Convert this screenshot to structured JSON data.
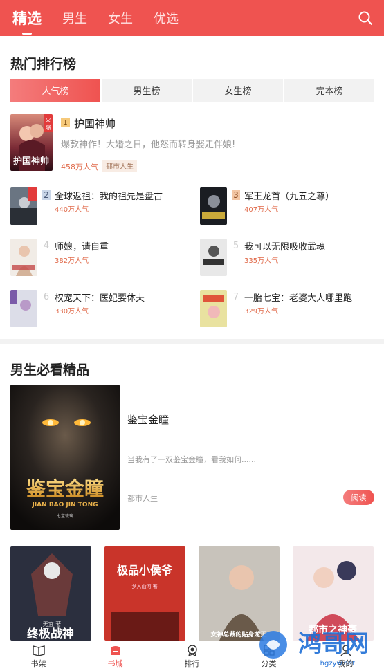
{
  "header": {
    "tabs": [
      "精选",
      "男生",
      "女生",
      "优选"
    ],
    "active_tab": "精选"
  },
  "hot_rank": {
    "title": "热门排行榜",
    "tabs": [
      "人气榜",
      "男生榜",
      "女生榜",
      "完本榜"
    ],
    "top1": {
      "rank": "1",
      "title": "护国神帅",
      "desc": "爆款神作！大婚之日，他怒而转身娶走伴娘!",
      "popularity": "458万人气",
      "tag": "都市人生",
      "cover_text": "护国神帅",
      "cover_badge": "火爆"
    },
    "items": [
      {
        "rank": "2",
        "title": "全球返祖：我的祖先是盘古",
        "popularity": "440万人气"
      },
      {
        "rank": "3",
        "title": "军王龙首（九五之尊）",
        "popularity": "407万人气"
      },
      {
        "rank": "4",
        "title": "师娘，请自重",
        "popularity": "382万人气"
      },
      {
        "rank": "5",
        "title": "我可以无限吸收武魂",
        "popularity": "335万人气"
      },
      {
        "rank": "6",
        "title": "权宠天下：医妃要休夫",
        "popularity": "330万人气"
      },
      {
        "rank": "7",
        "title": "一胎七宝：老婆大人哪里跑",
        "popularity": "329万人气"
      }
    ]
  },
  "featured": {
    "section_title": "男生必看精品",
    "book": {
      "title": "鉴宝金瞳",
      "desc": "当我有了一双鉴宝金瞳，看我如何......",
      "tag": "都市人生",
      "read_label": "阅读",
      "cover_title": "鉴宝金瞳",
      "cover_pinyin": "JIAN BAO JIN TONG",
      "cover_author": "七宝琉璃"
    },
    "row_covers": [
      {
        "text": "终极战神",
        "author": "无宜 著"
      },
      {
        "text": "极品小侯爷",
        "author": "梦入山河 著"
      },
      {
        "text": "女神总裁的贴身龙王",
        "author": ""
      },
      {
        "text": "都市之神豪",
        "author": ""
      }
    ]
  },
  "bottom_nav": {
    "items": [
      "书架",
      "书城",
      "排行",
      "分类",
      "我的"
    ],
    "active": "书城"
  },
  "watermark": {
    "text": "鸿哥网",
    "url": "hgzyw.net"
  }
}
